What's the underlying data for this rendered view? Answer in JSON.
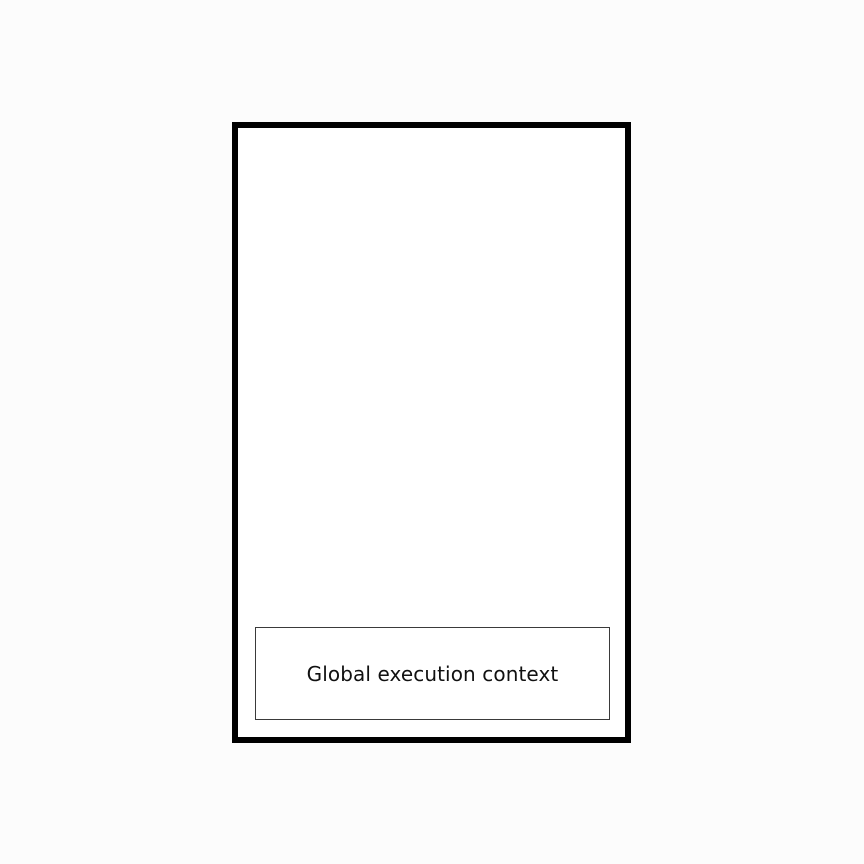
{
  "call_stack": {
    "frames": [
      {
        "label": "Global execution context"
      }
    ]
  },
  "colors": {
    "background": "#fcfcfc",
    "stack_border": "#000000",
    "frame_border": "#3a3a3a",
    "text": "#111111"
  }
}
